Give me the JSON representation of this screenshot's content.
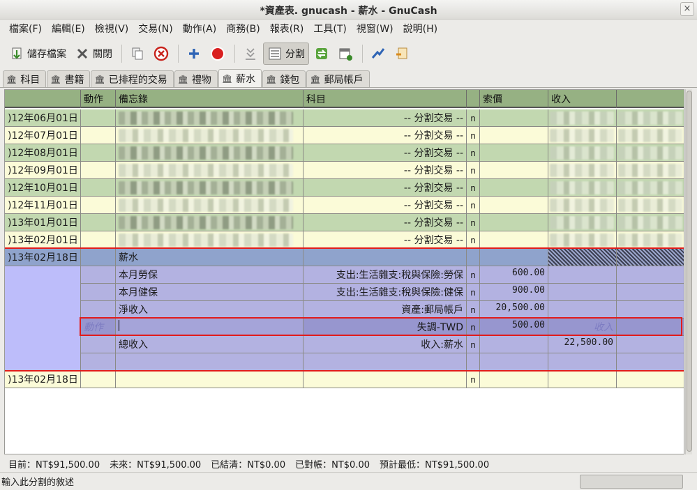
{
  "window": {
    "title": "*資產表. gnucash - 薪水 - GnuCash",
    "close": "×"
  },
  "menu": [
    "檔案(F)",
    "編輯(E)",
    "檢視(V)",
    "交易(N)",
    "動作(A)",
    "商務(B)",
    "報表(R)",
    "工具(T)",
    "視窗(W)",
    "說明(H)"
  ],
  "toolbar": {
    "save": "儲存檔案",
    "close": "關閉",
    "split": "分割"
  },
  "tabs": [
    "科目",
    "書籍",
    "已排程的交易",
    "禮物",
    "薪水",
    "錢包",
    "郵局帳戶"
  ],
  "active_tab": "薪水",
  "columns": {
    "date": "",
    "num": "動作",
    "desc": "備忘錄",
    "account": "科目",
    "recon": "",
    "debit": "索價",
    "credit": "收入",
    "extra": ""
  },
  "rows": [
    {
      "date": ")12年06月01日",
      "account": "-- 分割交易 --",
      "r": "n"
    },
    {
      "date": ")12年07月01日",
      "account": "-- 分割交易 --",
      "r": "n"
    },
    {
      "date": ")12年08月01日",
      "account": "-- 分割交易 --",
      "r": "n"
    },
    {
      "date": ")12年09月01日",
      "account": "-- 分割交易 --",
      "r": "n"
    },
    {
      "date": ")12年10月01日",
      "account": "-- 分割交易 --",
      "r": "n"
    },
    {
      "date": ")12年11月01日",
      "account": "-- 分割交易 --",
      "r": "n"
    },
    {
      "date": ")13年01月01日",
      "account": "-- 分割交易 --",
      "r": "n"
    },
    {
      "date": ")13年02月01日",
      "account": "-- 分割交易 --",
      "r": "n"
    }
  ],
  "current_txn": {
    "date": ")13年02月18日",
    "desc": "薪水",
    "splits": [
      {
        "memo": "本月勞保",
        "account": "支出:生活雜支:稅與保險:勞保",
        "r": "n",
        "debit": "600.00",
        "credit": ""
      },
      {
        "memo": "本月健保",
        "account": "支出:生活雜支:稅與保險:健保",
        "r": "n",
        "debit": "900.00",
        "credit": ""
      },
      {
        "memo": "淨收入",
        "account": "資產:郵局帳戶",
        "r": "n",
        "debit": "20,500.00",
        "credit": ""
      },
      {
        "memo": "",
        "account": "失調-TWD",
        "r": "n",
        "debit": "500.00",
        "credit": "",
        "action_placeholder": "動作",
        "credit_placeholder": "收入"
      },
      {
        "memo": "總收入",
        "account": "收入:薪水",
        "r": "n",
        "debit": "",
        "credit": "22,500.00"
      }
    ]
  },
  "blank_row": {
    "date": ")13年02月18日",
    "r": "n"
  },
  "summary": {
    "present": "目前：NT$91,500.00",
    "future": "未來：NT$91,500.00",
    "cleared": "已結清：NT$0.00",
    "reconciled": "已對帳：NT$0.00",
    "projected_min": "預計最低：NT$91,500.00"
  },
  "status": "輸入此分割的敘述"
}
